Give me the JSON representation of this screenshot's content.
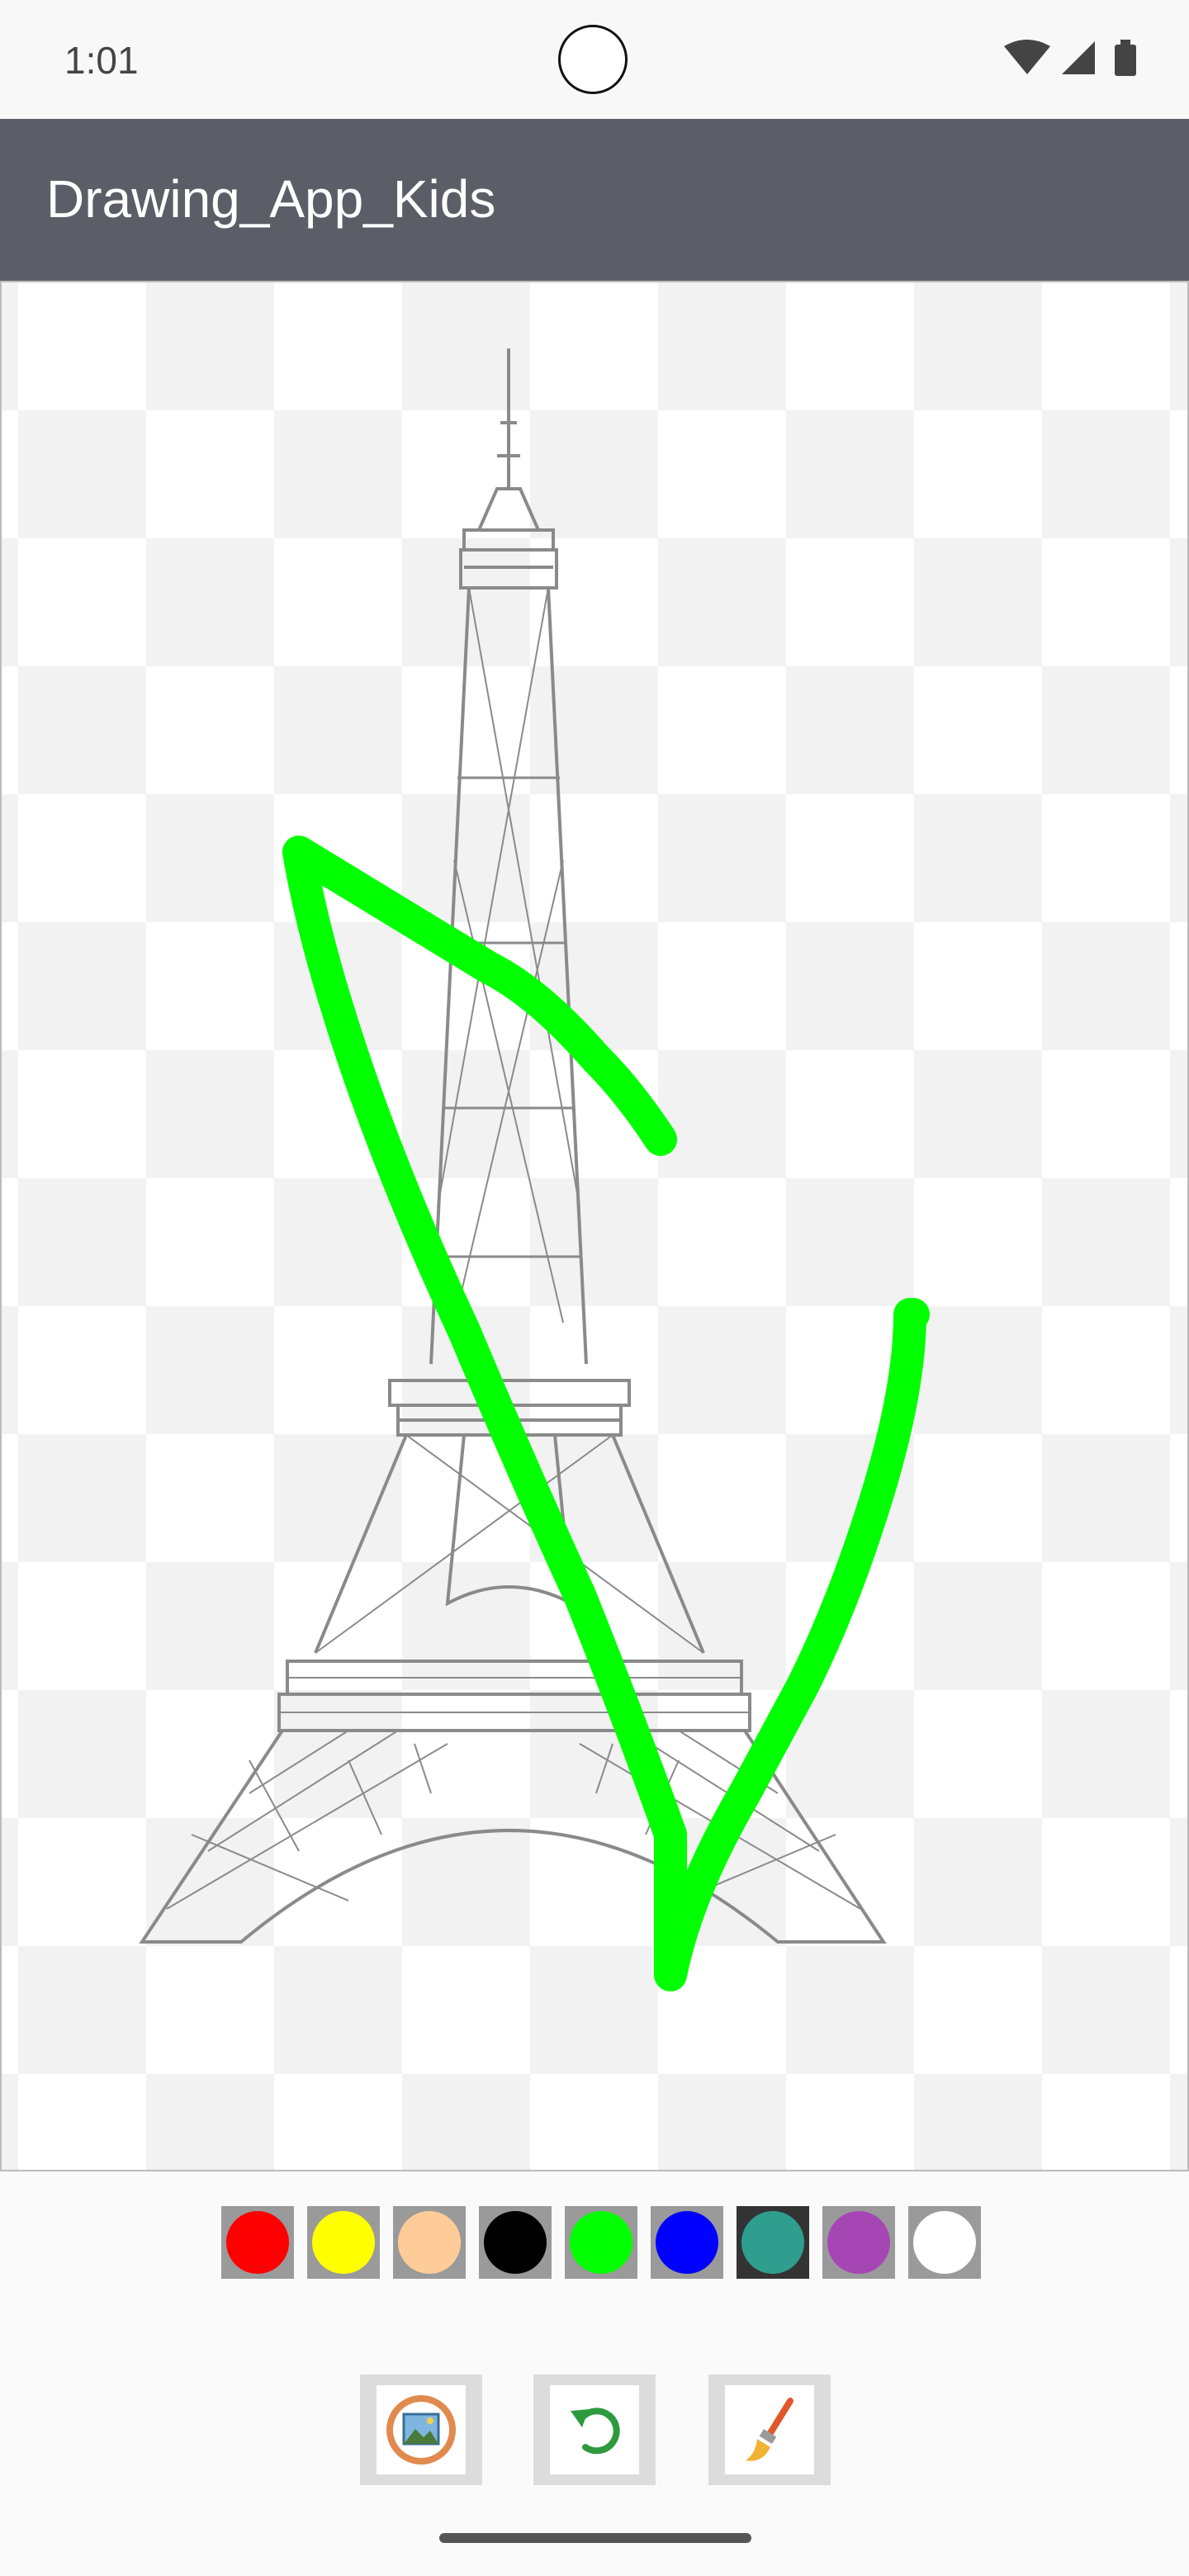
{
  "status_bar": {
    "time": "1:01",
    "icons": [
      "wifi-icon",
      "cell-signal-icon",
      "battery-icon"
    ]
  },
  "app_bar": {
    "title": "Drawing_App_Kids",
    "background": "#5b5e66"
  },
  "canvas": {
    "background_image": "eiffel-tower-line-drawing",
    "stroke_color": "#00ff00"
  },
  "palette": {
    "colors": [
      {
        "name": "red",
        "hex": "#ff0000"
      },
      {
        "name": "yellow",
        "hex": "#ffff00"
      },
      {
        "name": "skin",
        "hex": "#ffcc99"
      },
      {
        "name": "black",
        "hex": "#000000"
      },
      {
        "name": "green",
        "hex": "#00ff00"
      },
      {
        "name": "blue",
        "hex": "#0000ff"
      },
      {
        "name": "teal",
        "hex": "#2f9e8f"
      },
      {
        "name": "purple",
        "hex": "#a646b5"
      },
      {
        "name": "white",
        "hex": "#ffffff"
      }
    ],
    "selected": "teal"
  },
  "toolbar": {
    "buttons": [
      {
        "name": "gallery",
        "icon": "image-gallery-icon"
      },
      {
        "name": "undo",
        "icon": "undo-icon"
      },
      {
        "name": "brush",
        "icon": "paint-brush-icon"
      }
    ]
  }
}
